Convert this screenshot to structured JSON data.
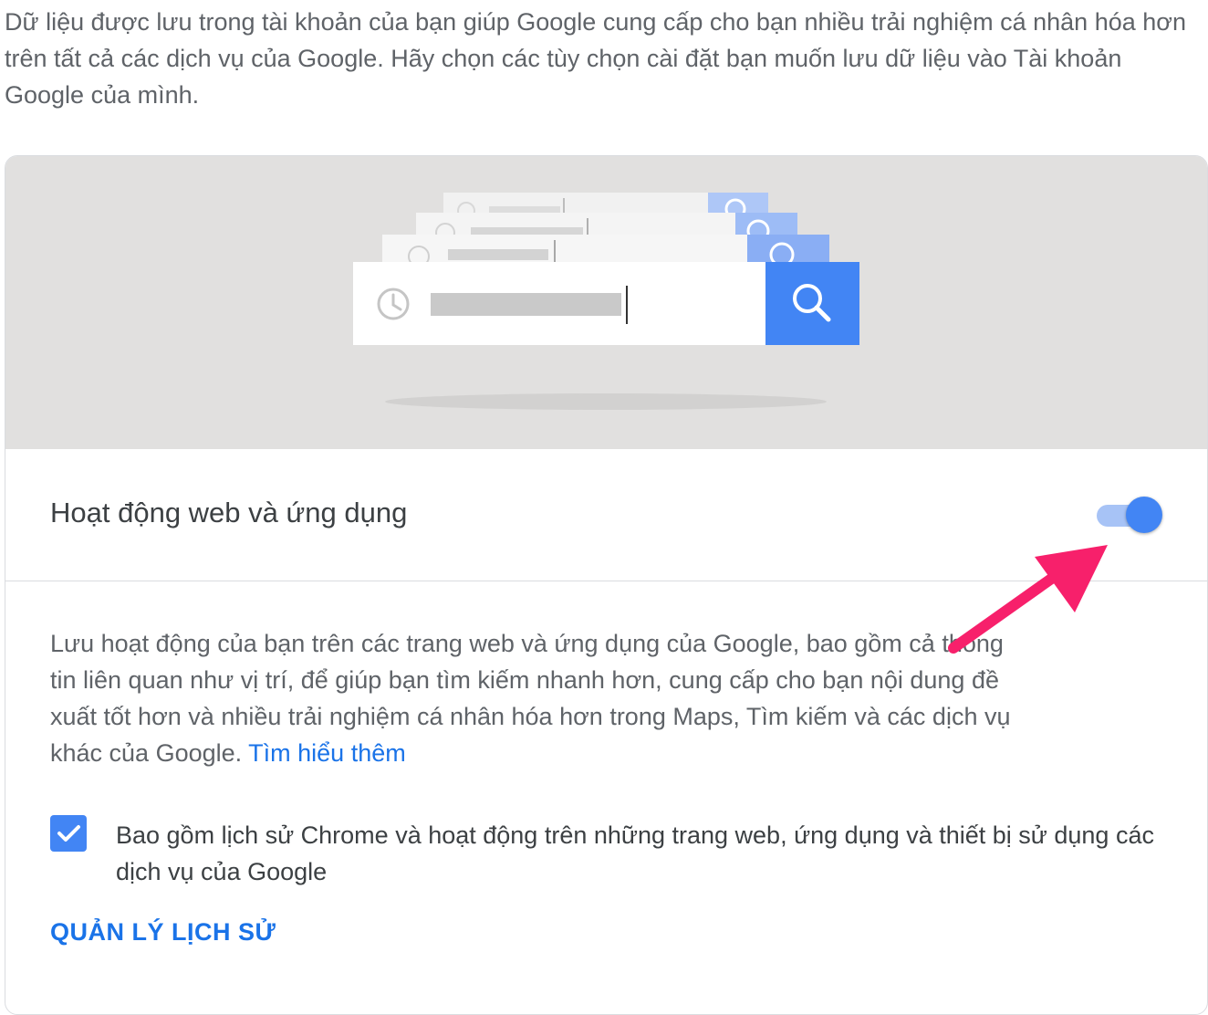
{
  "intro": {
    "text": "Dữ liệu được lưu trong tài khoản của bạn giúp Google cung cấp cho bạn nhiều trải nghiệm cá nhân hóa hơn trên tất cả các dịch vụ của Google. Hãy chọn các tùy chọn cài đặt bạn muốn lưu dữ liệu vào Tài khoản Google của mình."
  },
  "setting": {
    "title": "Hoạt động web và ứng dụng",
    "toggle_on": true,
    "description": "Lưu hoạt động của bạn trên các trang web và ứng dụng của Google, bao gồm cả thông tin liên quan như vị trí, để giúp bạn tìm kiếm nhanh hơn, cung cấp cho bạn nội dung đề xuất tốt hơn và nhiều trải nghiệm cá nhân hóa hơn trong Maps, Tìm kiếm và các dịch vụ khác của Google.",
    "learn_more": "Tìm hiểu thêm",
    "checkbox_checked": true,
    "checkbox_label": "Bao gồm lịch sử Chrome và hoạt động trên những trang web, ứng dụng và thiết bị sử dụng các dịch vụ của Google",
    "manage_link": "QUẢN LÝ LỊCH SỬ"
  },
  "icons": {
    "illustration_clock": "history-clock-icon",
    "illustration_search": "search-icon",
    "checkmark": "checkmark-icon",
    "annotation": "pink-arrow-icon"
  },
  "colors": {
    "accent_blue": "#4285f4",
    "link_blue": "#1a73e8",
    "toggle_track": "#a7c3f6",
    "illustration_bg": "#e1e0df",
    "annotation_pink": "#f7206b"
  }
}
